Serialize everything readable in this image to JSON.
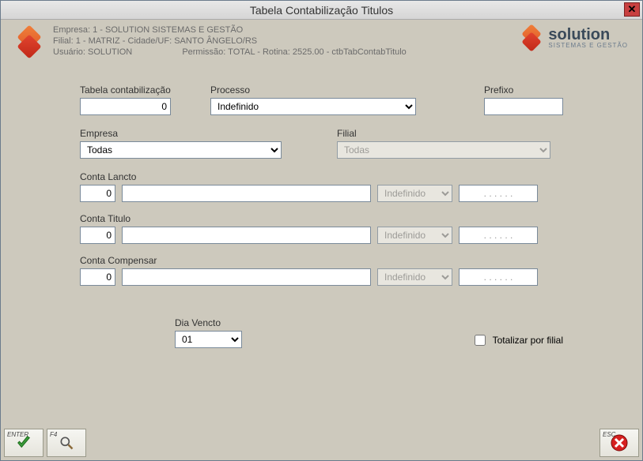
{
  "title": "Tabela Contabilização Titulos",
  "header": {
    "empresa": "Empresa: 1 - SOLUTION SISTEMAS E GESTÃO",
    "filial": "Filial: 1 - MATRIZ - Cidade/UF: SANTO ÂNGELO/RS",
    "usuario": "Usuário: SOLUTION",
    "permissao": "Permissão: TOTAL - Rotina: 2525.00 - ctbTabContabTitulo",
    "brand": "solution",
    "brand_sub": "SISTEMAS E GESTÃO"
  },
  "form": {
    "tabela_label": "Tabela contabilização",
    "tabela_value": "0",
    "processo_label": "Processo",
    "processo_value": "Indefinido",
    "prefixo_label": "Prefixo",
    "prefixo_value": "",
    "empresa_label": "Empresa",
    "empresa_value": "Todas",
    "filial_label": "Filial",
    "filial_value": "Todas",
    "conta_lancto_label": "Conta Lancto",
    "conta_titulo_label": "Conta Titulo",
    "conta_compensar_label": "Conta Compensar",
    "conta_code": "0",
    "conta_desc": "",
    "conta_tipo": "Indefinido",
    "conta_mask": ". . . . . .",
    "dia_vencto_label": "Dia Vencto",
    "dia_vencto_value": "01",
    "totalizar_label": "Totalizar por filial"
  },
  "footer": {
    "enter": "ENTER",
    "f4": "F4",
    "esc": "ESC"
  }
}
